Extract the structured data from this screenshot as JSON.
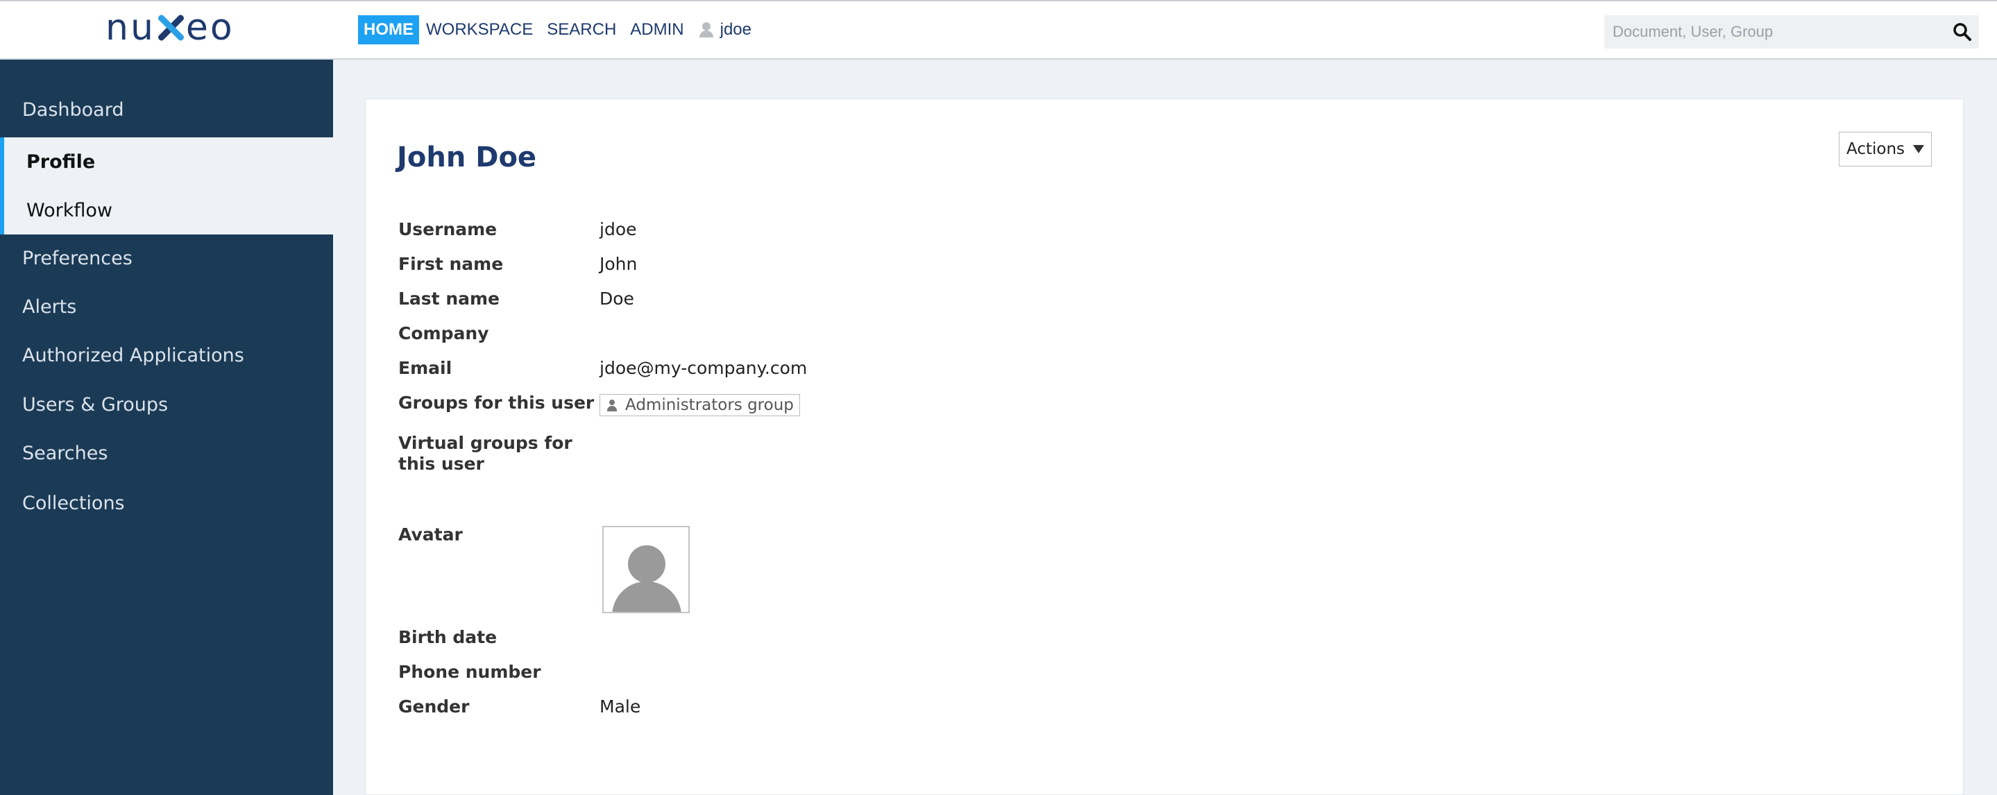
{
  "header": {
    "logo": "nuxeo",
    "nav": [
      "HOME",
      "WORKSPACE",
      "SEARCH",
      "ADMIN"
    ],
    "user": "jdoe",
    "search_placeholder": "Document, User, Group"
  },
  "sidebar": {
    "items": [
      {
        "label": "Dashboard"
      },
      {
        "label": "Profile"
      },
      {
        "label": "Workflow"
      },
      {
        "label": "Preferences"
      },
      {
        "label": "Alerts"
      },
      {
        "label": "Authorized Applications"
      },
      {
        "label": "Users & Groups"
      },
      {
        "label": "Searches"
      },
      {
        "label": "Collections"
      }
    ]
  },
  "profile": {
    "title": "John Doe",
    "actions_label": "Actions",
    "fields": [
      {
        "label": "Username",
        "value": "jdoe"
      },
      {
        "label": "First name",
        "value": "John"
      },
      {
        "label": "Last name",
        "value": "Doe"
      },
      {
        "label": "Company",
        "value": ""
      },
      {
        "label": "Email",
        "value": "jdoe@my-company.com"
      },
      {
        "label": "Groups for this user",
        "value": "Administrators group"
      },
      {
        "label": "Virtual groups for this user",
        "value": ""
      },
      {
        "label": "Avatar",
        "value": ""
      },
      {
        "label": "Birth date",
        "value": ""
      },
      {
        "label": "Phone number",
        "value": ""
      },
      {
        "label": "Gender",
        "value": "Male"
      }
    ]
  },
  "colors": {
    "sidebar_bg": "#1b3a55",
    "accent": "#1da1f2",
    "brand": "#1e3a6e"
  }
}
